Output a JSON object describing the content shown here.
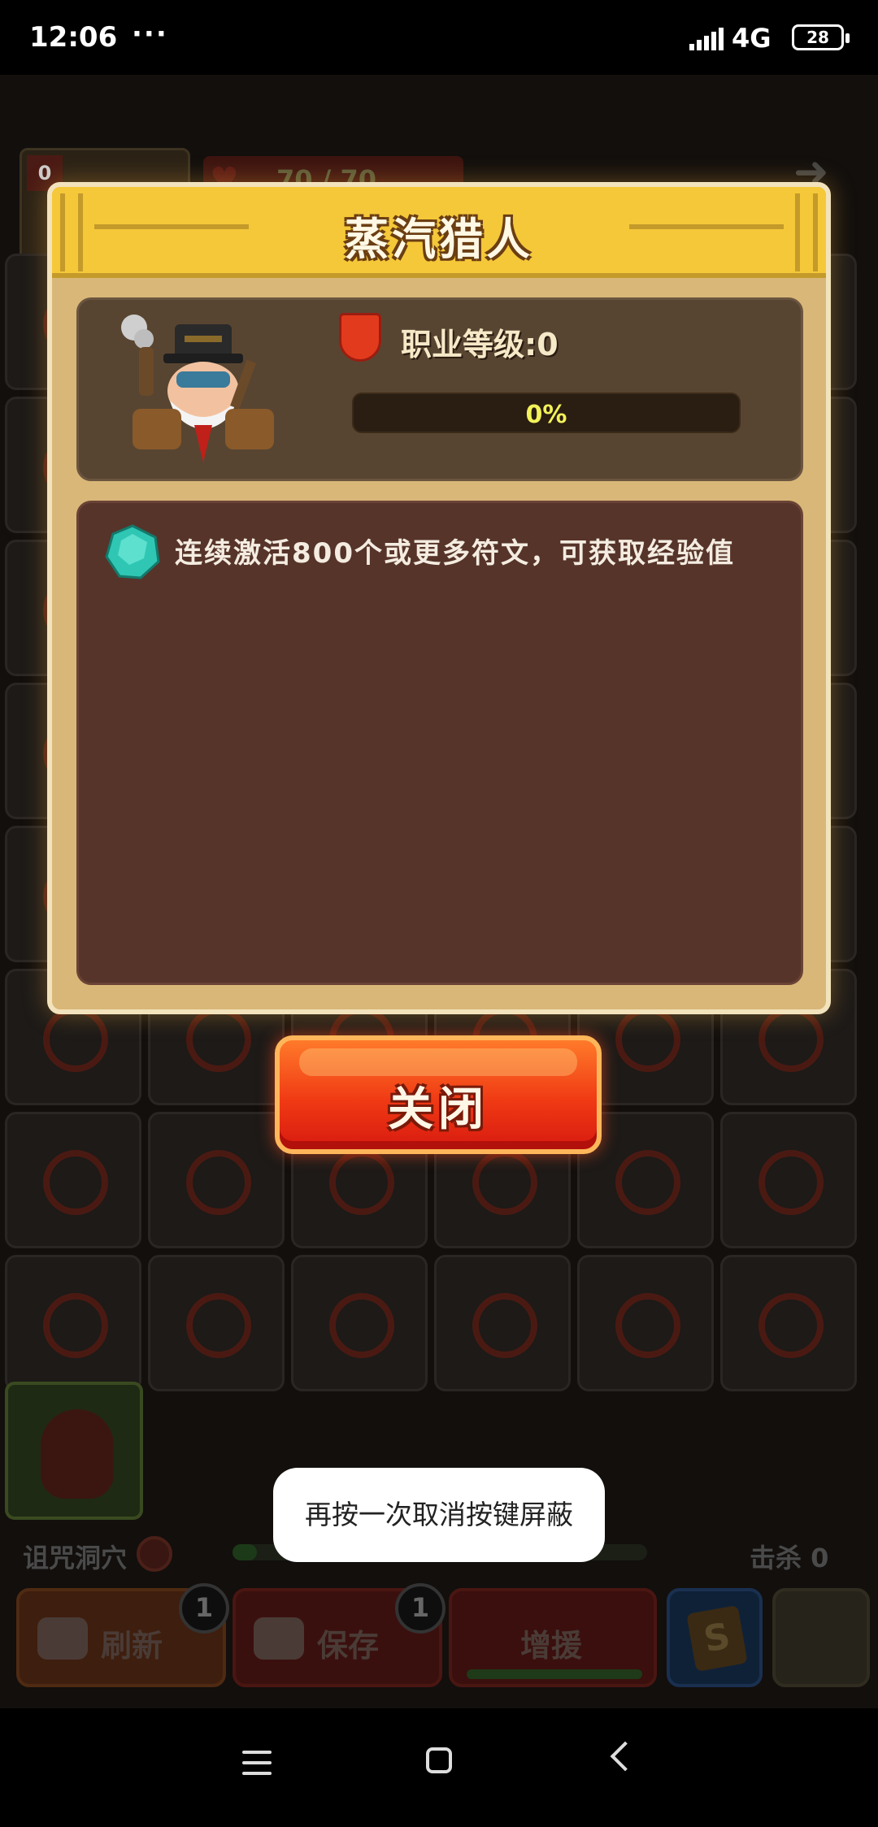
{
  "status_bar": {
    "time": "12:06",
    "dots": "···",
    "network": "4G",
    "battery": "28"
  },
  "game_hud": {
    "top_badge": "0",
    "hp_text": "70 / 70",
    "stage_label": "诅咒洞穴",
    "kills_label": "击杀 0"
  },
  "bottom_buttons": {
    "refresh_label": "刷新",
    "refresh_count": "1",
    "save_label": "保存",
    "save_count": "1",
    "boost_label": "增援",
    "s_label": "S"
  },
  "modal": {
    "title": "蒸汽猎人",
    "job_level_label": "职业等级:0",
    "exp_percent": "0%",
    "exp_progress": 0,
    "description": "连续激活800个或更多符文，可获取经验值",
    "close_label": "关闭"
  },
  "toast": {
    "message": "再按一次取消按键屏蔽"
  },
  "colors": {
    "modal_bg": "#d9b778",
    "header_gold": "#f5c83a",
    "close_red": "#f03a14",
    "gem_teal": "#2fc7b4"
  },
  "icons": [
    "signal-icon",
    "battery-icon",
    "heart-icon",
    "hunter-avatar-icon",
    "job-rank-icon",
    "gem-icon",
    "nav-menu-icon",
    "nav-home-icon",
    "nav-back-icon"
  ]
}
